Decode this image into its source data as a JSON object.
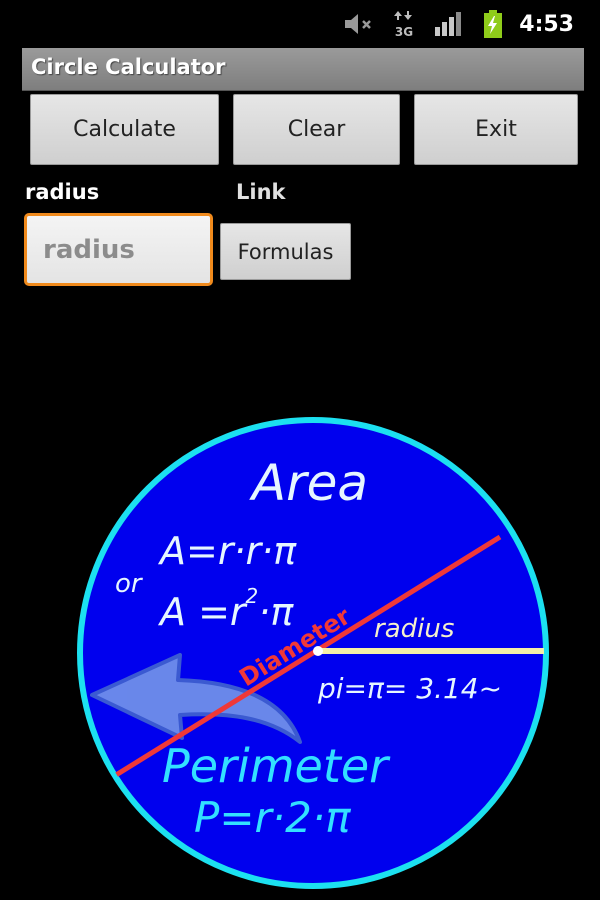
{
  "status_bar": {
    "time": "4:53",
    "icons": [
      "mute-icon",
      "network-3g-icon",
      "signal-strength-icon",
      "battery-charging-icon"
    ],
    "network_label": "3G",
    "battery_color": "#8fcc1a"
  },
  "app": {
    "title": "Circle Calculator"
  },
  "toolbar": {
    "calculate_label": "Calculate",
    "clear_label": "Clear",
    "exit_label": "Exit"
  },
  "form": {
    "radius_label": "radius",
    "radius_value": "",
    "radius_placeholder": "radius",
    "link_label": "Link",
    "formulas_button_label": "Formulas",
    "focus_color": "#f08a1c"
  },
  "diagram": {
    "area_title": "Area",
    "area_formula_1": "A=r·r·π",
    "or_label": "or",
    "area_formula_2_prefix": "A =r",
    "area_formula_2_exp": "2",
    "area_formula_2_suffix": "·π",
    "diameter_label": "Diameter",
    "radius_label": "radius",
    "pi_label": "pi=π= 3.14~",
    "perimeter_title": "Perimeter",
    "perimeter_formula": "P=r·2·π",
    "colors": {
      "fill": "#0000ee",
      "rim": "#1ce0f0",
      "diameter": "#f03838",
      "radius_line": "#f5f0a8",
      "text_light": "#e6f6ff",
      "text_cyan": "#33e0ff",
      "arrow": "#6f8fea"
    }
  }
}
